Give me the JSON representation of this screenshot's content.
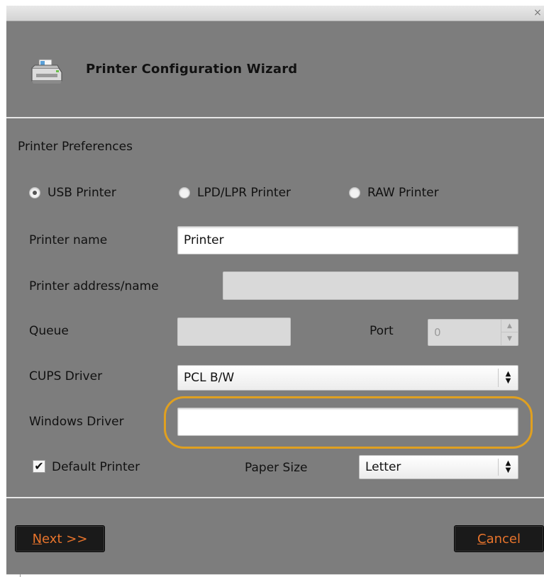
{
  "window": {
    "close_glyph": "×"
  },
  "wizard": {
    "title": "Printer Configuration Wizard",
    "icon": "printer-icon"
  },
  "preferences": {
    "section_title": "Printer Preferences",
    "connection_types": [
      {
        "label": "USB Printer",
        "selected": true
      },
      {
        "label": "LPD/LPR Printer",
        "selected": false
      },
      {
        "label": "RAW Printer",
        "selected": false
      }
    ],
    "printer_name": {
      "label": "Printer name",
      "value": "Printer"
    },
    "printer_address": {
      "label": "Printer address/name",
      "value": ""
    },
    "queue": {
      "label": "Queue",
      "value": ""
    },
    "port": {
      "label": "Port",
      "value": "0"
    },
    "cups_driver": {
      "label": "CUPS Driver",
      "value": "PCL B/W"
    },
    "windows_driver": {
      "label": "Windows Driver",
      "value": ""
    },
    "default_printer": {
      "label": "Default Printer",
      "checked": true
    },
    "paper_size": {
      "label": "Paper Size",
      "value": "Letter"
    }
  },
  "buttons": {
    "next": {
      "accel": "N",
      "rest": "ext >>"
    },
    "cancel": {
      "accel": "C",
      "rest": "ancel"
    }
  },
  "colors": {
    "dialog_bg": "#7d7d7d",
    "button_bg": "#1a1a1a",
    "button_text": "#e8742c",
    "highlight": "#e0a020"
  }
}
